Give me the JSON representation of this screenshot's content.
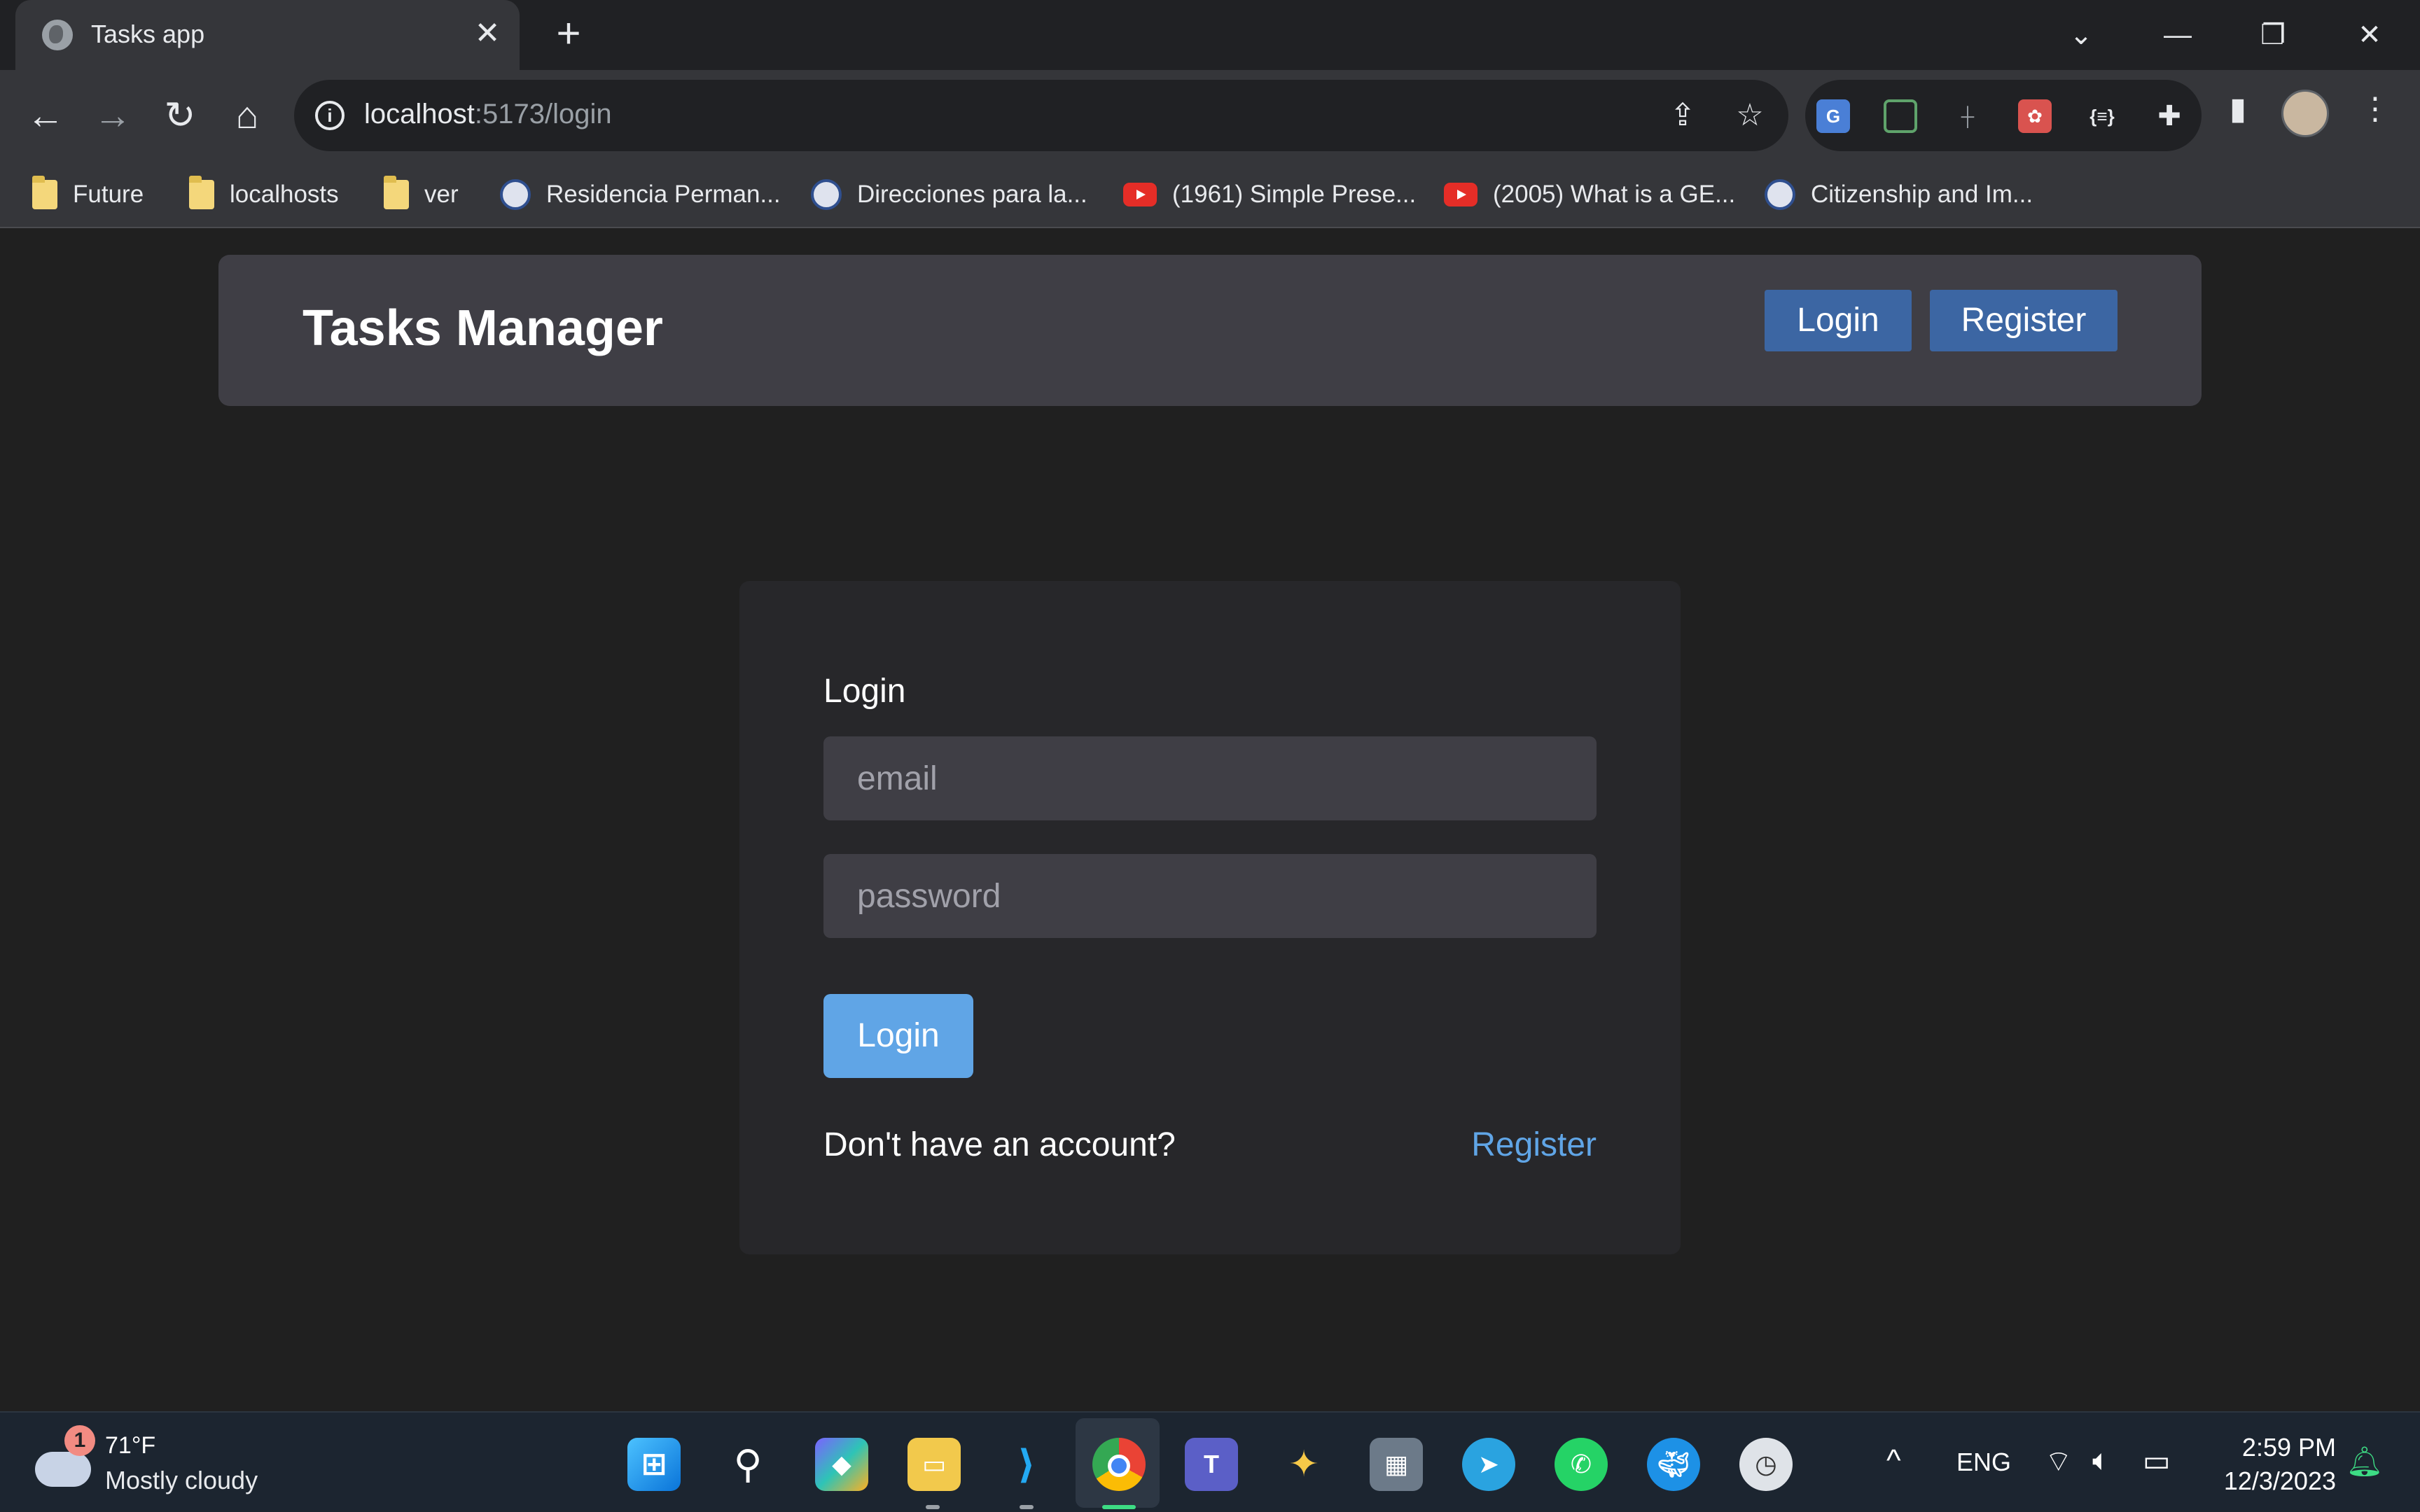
{
  "browser": {
    "tab_title": "Tasks app",
    "url_host": "localhost",
    "url_path": ":5173/login",
    "bookmarks": [
      {
        "label": "Future",
        "icon": "folder-icon"
      },
      {
        "label": "localhosts",
        "icon": "folder-icon"
      },
      {
        "label": "ver",
        "icon": "folder-icon"
      },
      {
        "label": "Residencia Perman...",
        "icon": "seal-icon"
      },
      {
        "label": "Direcciones para la...",
        "icon": "seal-icon"
      },
      {
        "label": "(1961) Simple Prese...",
        "icon": "youtube-icon"
      },
      {
        "label": "(2005) What is a GE...",
        "icon": "youtube-icon"
      },
      {
        "label": "Citizenship and Im...",
        "icon": "seal-icon"
      }
    ]
  },
  "navbar": {
    "brand": "Tasks Manager",
    "login_label": "Login",
    "register_label": "Register"
  },
  "login_form": {
    "title": "Login",
    "email_placeholder": "email",
    "password_placeholder": "password",
    "submit_label": "Login",
    "prompt": "Don't have an account?",
    "register_link": "Register"
  },
  "taskbar": {
    "weather_temp": "71°F",
    "weather_condition": "Mostly cloudy",
    "weather_badge": "1",
    "language": "ENG",
    "time": "2:59 PM",
    "date": "12/3/2023"
  },
  "colors": {
    "page_bg": "#202020",
    "navbar_bg": "#3f3e45",
    "nav_button": "#3c66a3",
    "primary_button": "#60a5e6",
    "link": "#60a5e6",
    "card_bg": "#27272a"
  }
}
